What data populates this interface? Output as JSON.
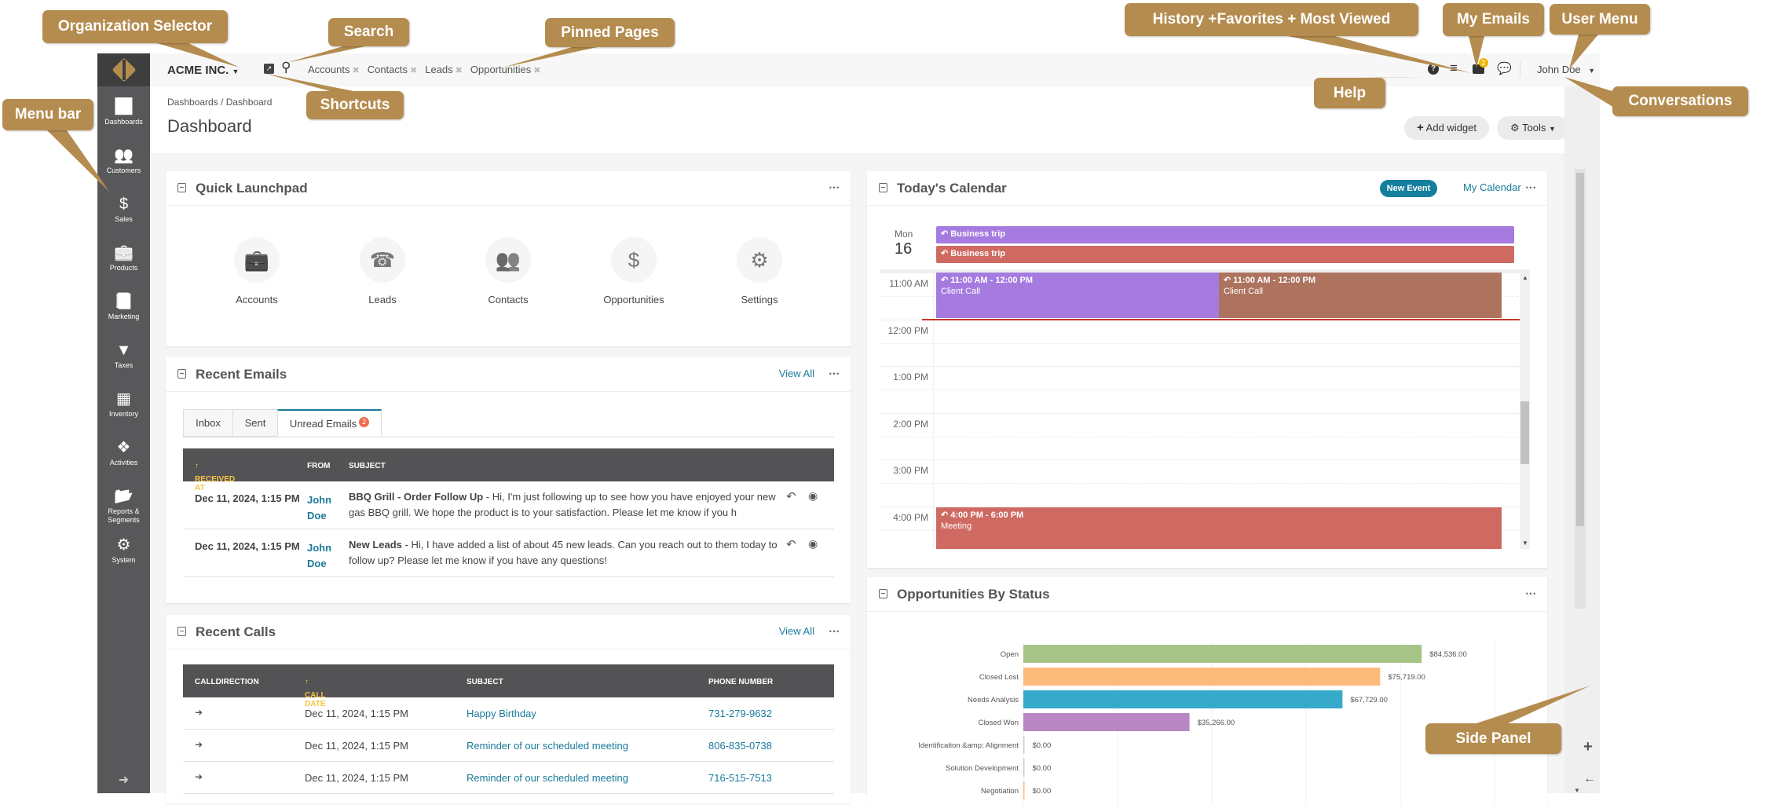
{
  "sidebar": {
    "items": [
      {
        "label": "Dashboards",
        "icon": "bar-chart-icon"
      },
      {
        "label": "Customers",
        "icon": "users-icon"
      },
      {
        "label": "Sales",
        "icon": "dollar-icon"
      },
      {
        "label": "Products",
        "icon": "briefcase-icon"
      },
      {
        "label": "Marketing",
        "icon": "book-icon"
      },
      {
        "label": "Taxes",
        "icon": "filter-icon"
      },
      {
        "label": "Inventory",
        "icon": "building-icon"
      },
      {
        "label": "Activities",
        "icon": "puzzle-icon"
      },
      {
        "label": "Reports & Segments",
        "icon": "folder-open-icon"
      },
      {
        "label": "System",
        "icon": "gear-icon"
      }
    ],
    "expand_icon": "arrow-right-icon"
  },
  "topbar": {
    "org": "ACME INC.",
    "pinned": [
      "Accounts",
      "Contacts",
      "Leads",
      "Opportunities"
    ],
    "email_count": "2",
    "user": "John Doe"
  },
  "page": {
    "breadcrumb": "Dashboards / Dashboard",
    "title": "Dashboard",
    "add_widget": "Add widget",
    "tools": "Tools"
  },
  "launchpad": {
    "title": "Quick Launchpad",
    "items": [
      {
        "label": "Accounts",
        "icon": "briefcase-icon"
      },
      {
        "label": "Leads",
        "icon": "phone-icon"
      },
      {
        "label": "Contacts",
        "icon": "users-icon"
      },
      {
        "label": "Opportunities",
        "icon": "dollar-icon"
      },
      {
        "label": "Settings",
        "icon": "gears-icon"
      }
    ]
  },
  "emails": {
    "title": "Recent Emails",
    "view_all": "View All",
    "tabs": [
      "Inbox",
      "Sent",
      "Unread Emails"
    ],
    "unread_count": "2",
    "columns": [
      "RECEIVED AT",
      "FROM",
      "SUBJECT"
    ],
    "rows": [
      {
        "date": "Dec 11, 2024, 1:15 PM",
        "from": "John Doe",
        "subject": "BBQ Grill - Order Follow Up",
        "body": " - Hi, I'm just following up to see how you have enjoyed your new gas BBQ grill. We hope the product is to your satisfaction. Please let me know if you h"
      },
      {
        "date": "Dec 11, 2024, 1:15 PM",
        "from": "John Doe",
        "subject": "New Leads",
        "body": " - Hi, I have added a list of about 45 new leads. Can you reach out to them today to follow up? Please let me know if you have any questions!"
      }
    ]
  },
  "calls": {
    "title": "Recent Calls",
    "view_all": "View All",
    "columns": [
      "CALLDIRECTION",
      "CALL DATE",
      "SUBJECT",
      "PHONE NUMBER"
    ],
    "rows": [
      {
        "date": "Dec 11, 2024, 1:15 PM",
        "subject": "Happy Birthday",
        "phone": "731-279-9632"
      },
      {
        "date": "Dec 11, 2024, 1:15 PM",
        "subject": "Reminder of our scheduled meeting",
        "phone": "806-835-0738"
      },
      {
        "date": "Dec 11, 2024, 1:15 PM",
        "subject": "Reminder of our scheduled meeting",
        "phone": "716-515-7513"
      }
    ]
  },
  "calendar": {
    "title": "Today's Calendar",
    "new_event": "New Event",
    "my_calendar": "My Calendar",
    "day": "Mon",
    "date": "16",
    "all_day": [
      {
        "title": "Business trip",
        "color": "#a57be0"
      },
      {
        "title": "Business trip",
        "color": "#cf6a62"
      }
    ],
    "hours": [
      "11:00 AM",
      "12:00 PM",
      "1:00 PM",
      "2:00 PM",
      "3:00 PM",
      "4:00 PM"
    ],
    "events": [
      {
        "time": "11:00 AM - 12:00 PM",
        "title": "Client Call",
        "color": "#a57be0"
      },
      {
        "time": "11:00 AM - 12:00 PM",
        "title": "Client Call",
        "color": "#ad735f"
      },
      {
        "time": "4:00 PM - 6:00 PM",
        "title": "Meeting",
        "color": "#cf6a62"
      }
    ]
  },
  "chart_data": {
    "type": "bar",
    "orientation": "horizontal",
    "title": "Opportunities By Status",
    "categories": [
      "Open",
      "Closed Lost",
      "Needs Analysis",
      "Closed Won",
      "Identification &amp; Alignment",
      "Solution Development",
      "Negotiation"
    ],
    "values": [
      84536,
      75719,
      67729,
      35266,
      0,
      0,
      0
    ],
    "data_labels": [
      "$84,536.00",
      "$75,719.00",
      "$67,729.00",
      "$35,266.00",
      "$0.00",
      "$0.00",
      "$0.00"
    ],
    "colors": [
      "#a6c486",
      "#fdbb7b",
      "#36aac8",
      "#b987c4",
      "#cccccc",
      "#cccccc",
      "#fdbb7b"
    ],
    "xlim": [
      0,
      100000
    ],
    "grid": true
  },
  "callouts": {
    "org": "Organization Selector",
    "search": "Search",
    "pinned": "Pinned Pages",
    "shortcuts": "Shortcuts",
    "menu": "Menu bar",
    "history": "History +Favorites + Most Viewed",
    "emails": "My Emails",
    "user": "User Menu",
    "help": "Help",
    "conversations": "Conversations",
    "side": "Side Panel"
  }
}
